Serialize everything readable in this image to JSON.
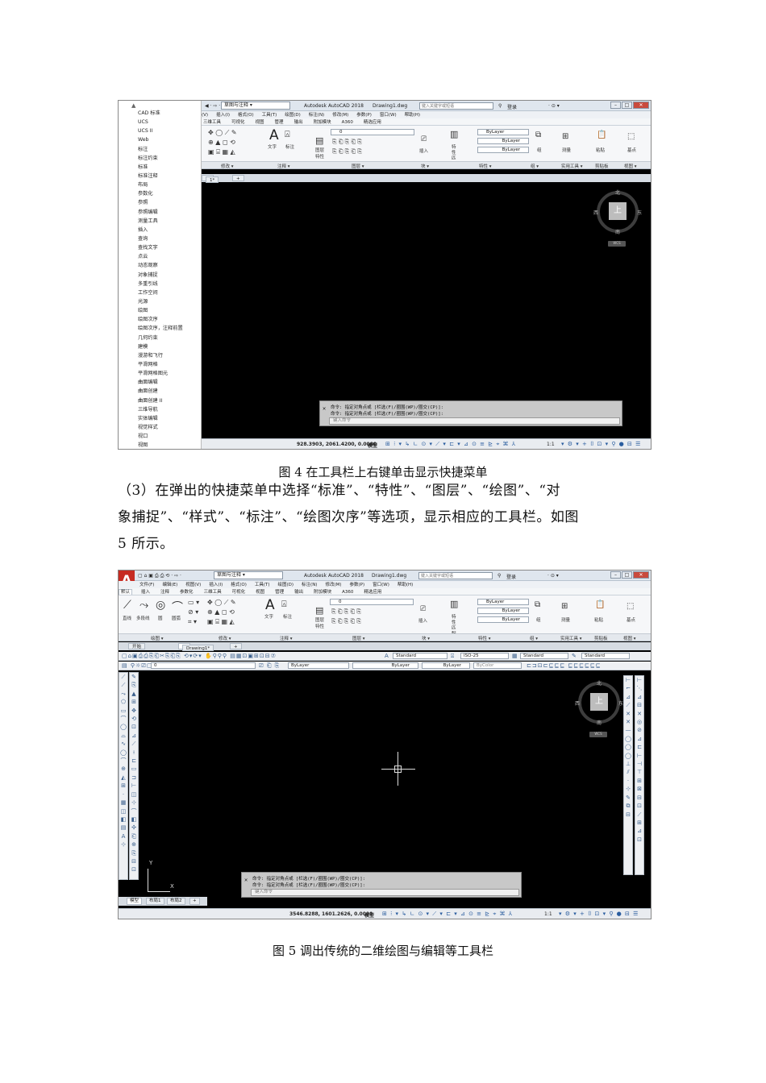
{
  "figure4": {
    "menu_items": [
      "CAD 标准",
      "UCS",
      "UCS II",
      "Web",
      "标注",
      "标注约束",
      "标准",
      "标准注释",
      "布局",
      "参数化",
      "参照",
      "参照编辑",
      "测量工具",
      "插入",
      "查询",
      "查找文字",
      "点云",
      "动态观察",
      "对象捕捉",
      "多重引线",
      "工作空间",
      "光源",
      "绘图",
      "绘图次序",
      "绘图次序，注释前置",
      "几何约束",
      "建模",
      "漫游和飞行",
      "平滑网格",
      "平滑网格图元",
      "曲面编辑",
      "曲面创建",
      "曲面创建 II",
      "三维导航",
      "实体编辑",
      "视觉样式",
      "视口",
      "视图"
    ],
    "app": {
      "workspace": "草图与注释",
      "app_title": "Autodesk AutoCAD 2018",
      "file_name": "Drawing1.dwg",
      "search_placeholder": "键入关键字或短语",
      "login": "登录",
      "menu": [
        "(V)",
        "插入(I)",
        "格式(O)",
        "工具(T)",
        "绘图(D)",
        "标注(N)",
        "修改(M)",
        "参数(P)",
        "窗口(W)",
        "帮助(H)"
      ],
      "ribbon_tabs": [
        "三维工具",
        "可视化",
        "视图",
        "管理",
        "输出",
        "附加模块",
        "A360",
        "精选应用"
      ],
      "ribbon_labels": {
        "text": "文字",
        "dim": "标注",
        "layer": "图层特性",
        "insert": "插入",
        "match": "特性匹配",
        "group": "组",
        "measure": "测量",
        "paste": "粘贴",
        "base": "基点"
      },
      "bylayer": "ByLayer",
      "layer_value": "0",
      "panels": [
        "修改 ▾",
        "注释 ▾",
        "图层 ▾",
        "块 ▾",
        "特性 ▾",
        "组 ▾",
        "实用工具 ▾",
        "剪贴板",
        "视图 ▾"
      ],
      "doc_tab": "1*",
      "viewcube": {
        "north": "北",
        "south": "南",
        "west": "西",
        "east": "东",
        "top": "上",
        "wcs": "WCS"
      },
      "cmd_line1": "命令: 指定对角点或 [栏选(F)/圈围(WP)/圈交(CP)]:",
      "cmd_line2": "命令: 指定对角点或 [栏选(F)/圈围(WP)/圈交(CP)]:",
      "cmd_placeholder": "键入命令",
      "coords": "928.3903, 2061.4200, 0.0000",
      "model": "模型",
      "scale": "1:1"
    },
    "caption": "图 4 在工具栏上右键单击显示快捷菜单"
  },
  "paragraph": {
    "line1": "（3）在弹出的快捷菜单中选择“标准”、“特性”、“图层”、“绘图”、“对",
    "line2": "象捕捉”、“样式”、“标注”、“绘图次序”等选项，显示相应的工具栏。如图",
    "line3": "5 所示。"
  },
  "figure5": {
    "app": {
      "workspace": "草图与注释",
      "app_title": "Autodesk AutoCAD 2018",
      "file_name": "Drawing1.dwg",
      "search_placeholder": "键入关键字或短语",
      "login": "登录",
      "menu": [
        "文件(F)",
        "编辑(E)",
        "视图(V)",
        "插入(I)",
        "格式(O)",
        "工具(T)",
        "绘图(D)",
        "标注(N)",
        "修改(M)",
        "参数(P)",
        "窗口(W)",
        "帮助(H)"
      ],
      "ribbon_tabs": [
        "默认",
        "插入",
        "注释",
        "参数化",
        "三维工具",
        "可视化",
        "视图",
        "管理",
        "输出",
        "附加模块",
        "A360",
        "精选应用"
      ],
      "draw_labels": [
        "直线",
        "多段线",
        "圆",
        "圆弧"
      ],
      "ribbon_labels": {
        "text": "文字",
        "dim": "标注",
        "layer": "图层特性",
        "insert": "插入",
        "match": "特性匹配",
        "group": "组",
        "measure": "测量",
        "paste": "粘贴",
        "base": "基点"
      },
      "bylayer": "ByLayer",
      "bycolor": "ByColor",
      "layer_value": "0",
      "panels": [
        "绘图 ▾",
        "修改 ▾",
        "注释 ▾",
        "图层 ▾",
        "块 ▾",
        "特性 ▾",
        "组 ▾",
        "实用工具 ▾",
        "剪贴板",
        "视图 ▾"
      ],
      "doc_tabs": [
        "开始",
        "Drawing1*"
      ],
      "styles": {
        "text": "Standard",
        "dim": "ISO-25",
        "table": "Standard",
        "mleader": "Standard"
      },
      "viewcube": {
        "north": "北",
        "south": "南",
        "west": "西",
        "east": "东",
        "top": "上",
        "wcs": "WCS"
      },
      "ucs_y": "Y",
      "ucs_x": "X",
      "layout_tabs": [
        "模型",
        "布局1",
        "布局2"
      ],
      "cmd_line1": "命令: 指定对角点或 [栏选(F)/圈围(WP)/圈交(CP)]:",
      "cmd_line2": "命令: 指定对角点或 [栏选(F)/圈围(WP)/圈交(CP)]:",
      "cmd_placeholder": "键入命令",
      "coords": "3546.8288, 1601.2626, 0.0000",
      "model": "模型",
      "scale": "1:1"
    },
    "caption": "图 5 调出传统的二维绘图与编辑等工具栏"
  }
}
